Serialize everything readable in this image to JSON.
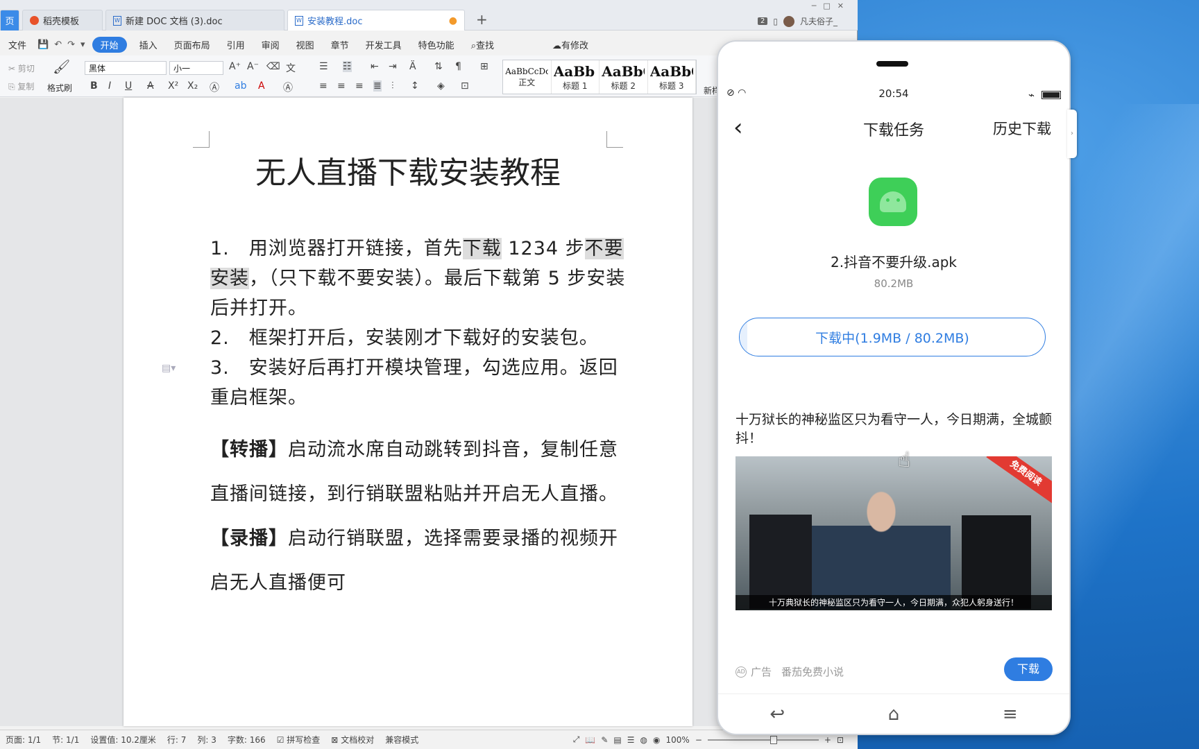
{
  "wps": {
    "tabs": [
      {
        "label": "页"
      },
      {
        "label": "稻壳模板"
      },
      {
        "label": "新建 DOC 文档 (3).doc"
      },
      {
        "label": "安装教程.doc"
      }
    ],
    "new_tab": "+",
    "badge": "2",
    "user": "凡夫俗子_",
    "menu": {
      "file": "文件",
      "items": [
        "开始",
        "插入",
        "页面布局",
        "引用",
        "审阅",
        "视图",
        "章节",
        "开发工具",
        "特色功能"
      ],
      "search": "查找",
      "changes": "有修改"
    },
    "ribbon": {
      "cut": "剪切",
      "copy": "复制",
      "format_painter": "格式刷",
      "font": "黑体",
      "size": "小一",
      "styles": [
        {
          "sample": "AaBbCcDd",
          "name": "正文"
        },
        {
          "sample": "AaBb",
          "name": "标题 1"
        },
        {
          "sample": "AaBbC",
          "name": "标题 2"
        },
        {
          "sample": "AaBbC",
          "name": "标题 3"
        }
      ],
      "new_style": "新样"
    },
    "document": {
      "title": "无人直播下载安装教程",
      "step1_a": "1.　用浏览器打开链接，首先",
      "step1_hl1": "下载",
      "step1_b": " 1234 步",
      "step1_hl2": "不要安装",
      "step1_c": "，（只下载不要安装）。最后下载第 5 步安装后并打开。",
      "step2": "2.　框架打开后，安装刚才下载好的安装包。",
      "step3": "3.　安装好后再打开模块管理，勾选应用。返回重启框架。",
      "sec1_head": "【转播】",
      "sec1_body": "启动流水席自动跳转到抖音，复制任意直播间链接，到行销联盟粘贴并开启无人直播。",
      "sec2_head": "【录播】",
      "sec2_body": "启动行销联盟，选择需要录播的视频开启无人直播便可"
    },
    "status": {
      "page": "页面: 1/1",
      "section": "节: 1/1",
      "setting": "设置值: 10.2厘米",
      "row": "行: 7",
      "col": "列: 3",
      "words": "字数: 166",
      "spell": "拼写检查",
      "proof": "文档校对",
      "compat": "兼容模式",
      "zoom": "100%"
    }
  },
  "phone": {
    "time": "20:54",
    "title": "下载任务",
    "history": "历史下载",
    "file_name": "2.抖音不要升级.apk",
    "file_size": "80.2MB",
    "progress_label": "下载中(1.9MB / 80.2MB)",
    "progress_fraction": 0.024,
    "ad": {
      "title": "十万狱长的神秘监区只为看守一人，今日期满，全城颤抖！",
      "ribbon": "免费阅读",
      "caption": "十万典狱长的神秘监区只为看守一人，今日期满，众犯人躬身送行！",
      "label": "广告",
      "source": "番茄免费小说",
      "button": "下载"
    }
  },
  "colors": {
    "accent": "#2f7de1",
    "android_green": "#3ecf58"
  }
}
